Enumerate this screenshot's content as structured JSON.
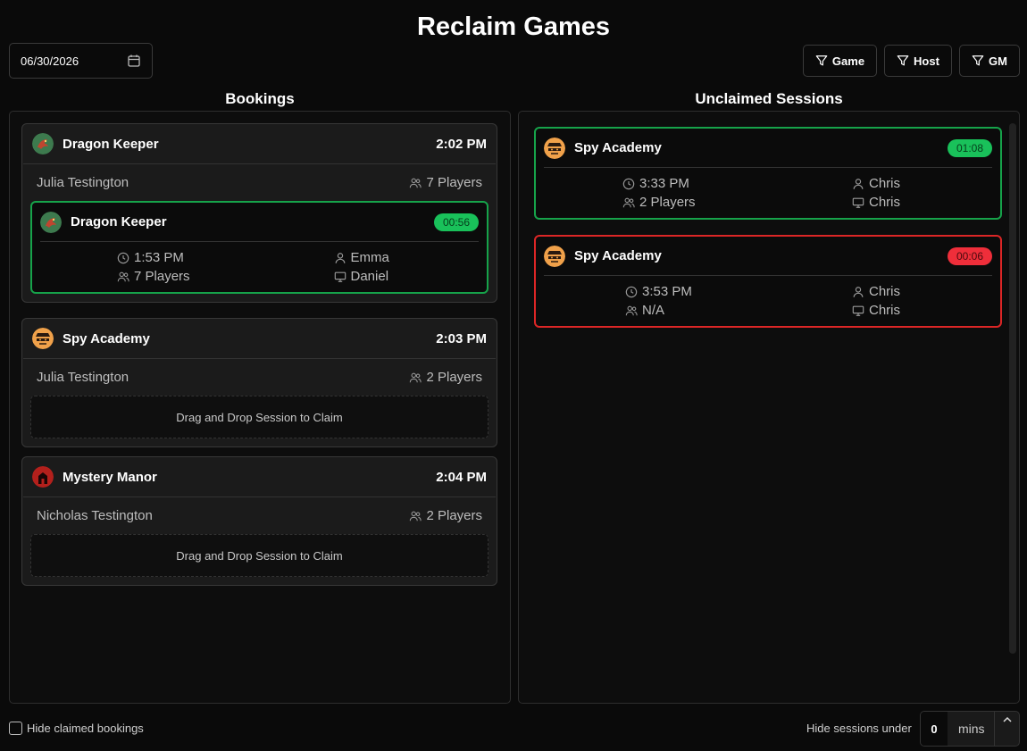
{
  "title": "Reclaim Games",
  "date": "06/30/2026",
  "filters": [
    "Game",
    "Host",
    "GM"
  ],
  "columns": {
    "bookings": "Bookings",
    "unclaimed": "Unclaimed Sessions"
  },
  "bookings": [
    {
      "game": "Dragon Keeper",
      "time": "2:02 PM",
      "customer": "Julia Testington",
      "players": "7 Players",
      "session": {
        "game": "Dragon Keeper",
        "badge": "00:56",
        "time": "1:53 PM",
        "host": "Emma",
        "players": "7 Players",
        "gm": "Daniel"
      }
    },
    {
      "game": "Spy Academy",
      "time": "2:03 PM",
      "customer": "Julia Testington",
      "players": "2 Players",
      "drop_text": "Drag and Drop Session to Claim"
    },
    {
      "game": "Mystery Manor",
      "time": "2:04 PM",
      "customer": "Nicholas Testington",
      "players": "2 Players",
      "drop_text": "Drag and Drop Session to Claim"
    }
  ],
  "unclaimed": [
    {
      "game": "Spy Academy",
      "badge": "01:08",
      "status": "green",
      "time": "3:33 PM",
      "host": "Chris",
      "players": "2 Players",
      "gm": "Chris"
    },
    {
      "game": "Spy Academy",
      "badge": "00:06",
      "status": "red",
      "time": "3:53 PM",
      "host": "Chris",
      "players": "N/A",
      "gm": "Chris"
    }
  ],
  "footer": {
    "hide_claimed": "Hide claimed bookings",
    "hide_sessions": "Hide sessions under",
    "mins_value": "0",
    "mins_unit": "mins"
  },
  "colors": {
    "green": "#16a34a",
    "red": "#dc2626",
    "badge_green": "#19c15a",
    "badge_red": "#ef2e3a"
  },
  "icons": {
    "dragon": "dragon-game-icon",
    "spy": "spy-game-icon",
    "manor": "manor-game-icon"
  }
}
